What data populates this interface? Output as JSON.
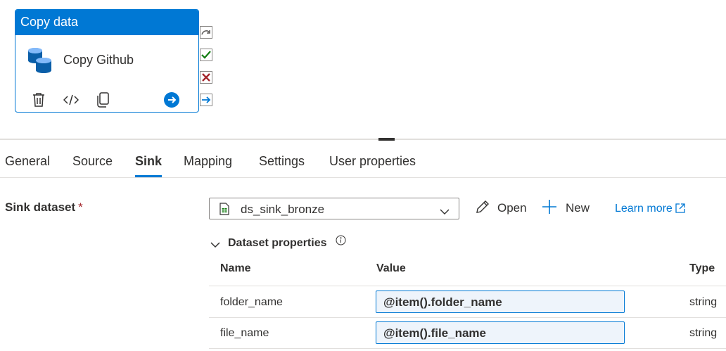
{
  "activity": {
    "type_label": "Copy data",
    "name": "Copy Github",
    "tools": [
      "delete-icon",
      "code-icon",
      "clone-icon",
      "go-icon"
    ],
    "connectors": [
      "skip-icon",
      "success-icon",
      "failure-icon",
      "completion-icon"
    ]
  },
  "tabs": [
    {
      "label": "General",
      "active": false
    },
    {
      "label": "Source",
      "active": false
    },
    {
      "label": "Sink",
      "active": true
    },
    {
      "label": "Mapping",
      "active": false
    },
    {
      "label": "Settings",
      "active": false
    },
    {
      "label": "User properties",
      "active": false
    }
  ],
  "sink": {
    "label": "Sink dataset",
    "required_mark": "*",
    "dataset_value": "ds_sink_bronze",
    "open_label": "Open",
    "new_label": "New",
    "learn_more_label": "Learn more"
  },
  "dataset_properties": {
    "title": "Dataset properties",
    "columns": [
      "Name",
      "Value",
      "Type"
    ],
    "rows": [
      {
        "name": "folder_name",
        "value": "@item().folder_name",
        "type": "string"
      },
      {
        "name": "file_name",
        "value": "@item().file_name",
        "type": "string"
      }
    ]
  },
  "colors": {
    "accent": "#0078d4",
    "success": "#107c10",
    "failure": "#a4262c",
    "required": "#a4262c"
  }
}
